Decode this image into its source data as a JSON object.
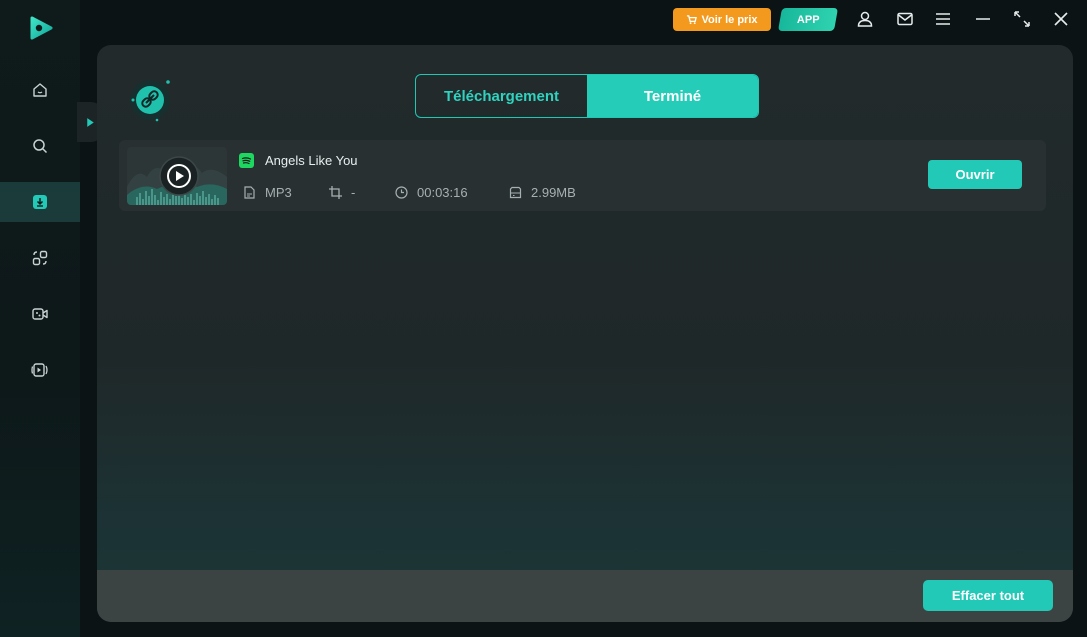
{
  "header": {
    "price_label": "Voir le prix",
    "app_label": "APP",
    "icons": [
      "user-icon",
      "mail-icon",
      "menu-icon",
      "minimize-icon",
      "maximize-icon",
      "close-icon"
    ]
  },
  "sidebar": {
    "items": [
      {
        "name": "home",
        "icon": "home-icon",
        "active": false
      },
      {
        "name": "search",
        "icon": "search-icon",
        "active": false
      },
      {
        "name": "downloads",
        "icon": "download-icon",
        "active": true
      },
      {
        "name": "convert",
        "icon": "convert-icon",
        "active": false
      },
      {
        "name": "record",
        "icon": "record-icon",
        "active": false
      },
      {
        "name": "player",
        "icon": "video-player-icon",
        "active": false
      }
    ]
  },
  "tabs": {
    "downloading": "Téléchargement",
    "finished": "Terminé",
    "active": "finished"
  },
  "item": {
    "title": "Angels Like You",
    "format": "MP3",
    "resolution": "-",
    "duration": "00:03:16",
    "size": "2.99MB",
    "open_label": "Ouvrir"
  },
  "footer": {
    "clear_label": "Effacer tout"
  },
  "colors": {
    "accent": "#22c9b6",
    "price": "#f39a1e",
    "spotify": "#1ed760"
  }
}
